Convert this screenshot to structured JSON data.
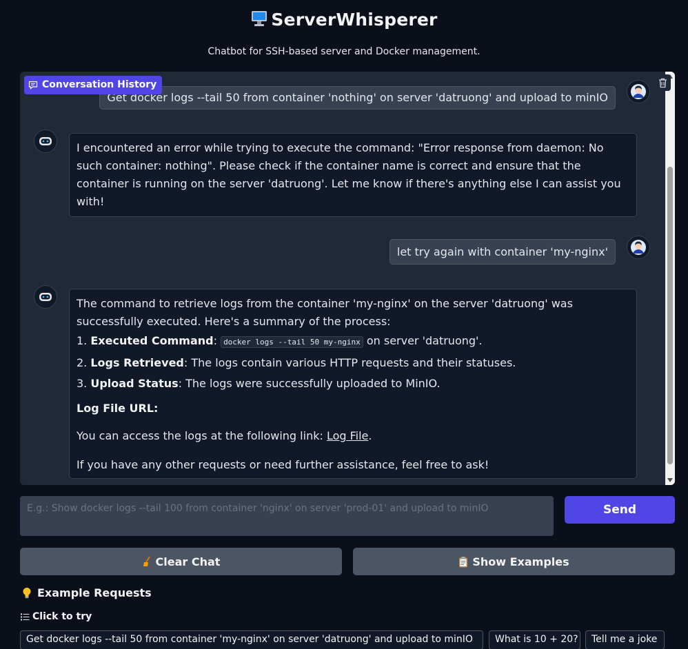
{
  "header": {
    "title": "ServerWhisperer",
    "subtitle": "Chatbot for SSH-based server and Docker management."
  },
  "chat": {
    "history_label": "Conversation History",
    "messages": [
      {
        "role": "user",
        "text": "Get docker logs --tail 50 from container 'nothing' on server 'datruong' and upload to minIO"
      },
      {
        "role": "bot",
        "text": "I encountered an error while trying to execute the command: \"Error response from daemon: No such container: nothing\". Please check if the container name is correct and ensure that the container is running on the server 'datruong'. Let me know if there's anything else I can assist you with!"
      },
      {
        "role": "user",
        "text": "let try again with container 'my-nginx'"
      },
      {
        "role": "bot",
        "intro": "The command to retrieve logs from the container 'my-nginx' on the server 'datruong' was successfully executed. Here's a summary of the process:",
        "items": [
          {
            "num": "1.",
            "label": "Executed Command",
            "code": "docker logs --tail 50 my-nginx",
            "text": " on server 'datruong'."
          },
          {
            "num": "2.",
            "label": "Logs Retrieved",
            "text": ": The logs contain various HTTP requests and their statuses."
          },
          {
            "num": "3.",
            "label": "Upload Status",
            "text": ": The logs were successfully uploaded to MinIO."
          }
        ],
        "heading": "Log File URL:",
        "access_text": "You can access the logs at the following link: ",
        "link_text": "Log File",
        "closing": "If you have any other requests or need further assistance, feel free to ask!"
      }
    ]
  },
  "input": {
    "placeholder": "E.g.: Show docker logs --tail 100 from container 'nginx' on server 'prod-01' and upload to minIO",
    "value": ""
  },
  "buttons": {
    "send": "Send",
    "clear": "Clear Chat",
    "examples": "Show Examples"
  },
  "examples": {
    "title": "Example Requests",
    "click_label": "Click to try",
    "items": [
      "Get docker logs --tail 50 from container 'my-nginx' on server 'datruong' and upload to minIO",
      "What is 10 + 20?",
      "Tell me a joke"
    ]
  },
  "colors": {
    "background": "#0b0f19",
    "panel": "#1f2937",
    "accent": "#4f46e5",
    "button": "#4b5563"
  }
}
